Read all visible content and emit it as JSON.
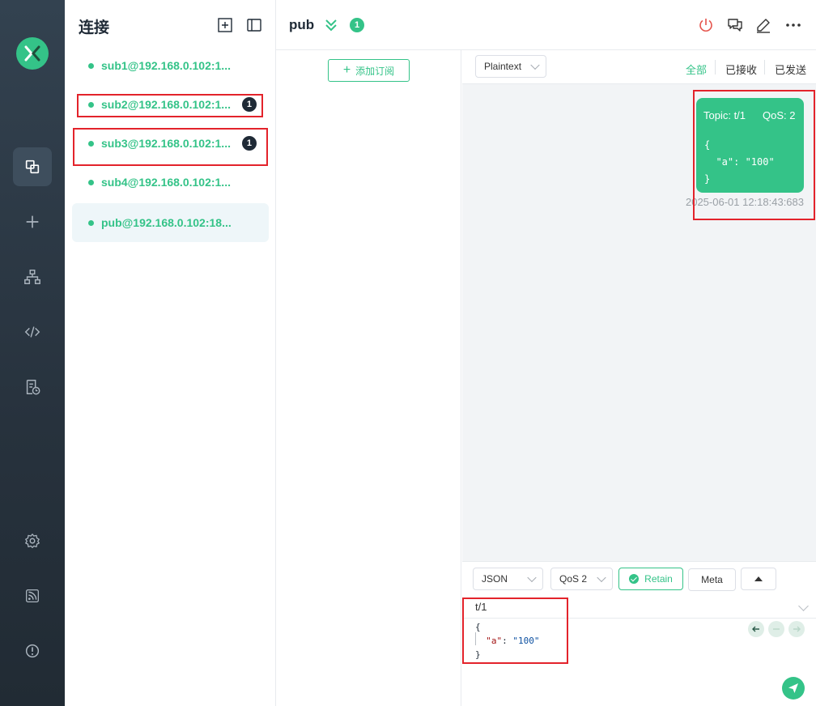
{
  "connections": {
    "title": "连接",
    "items": [
      {
        "name": "sub1@192.168.0.102:1...",
        "badge": ""
      },
      {
        "name": "sub2@192.168.0.102:1...",
        "badge": "1"
      },
      {
        "name": "sub3@192.168.0.102:1...",
        "badge": "1"
      },
      {
        "name": "sub4@192.168.0.102:1...",
        "badge": ""
      },
      {
        "name": "pub@192.168.0.102:18...",
        "badge": ""
      }
    ]
  },
  "header": {
    "title": "pub",
    "badge": "1"
  },
  "subscriptions": {
    "add_label": "添加订阅"
  },
  "messages": {
    "format_select": "Plaintext",
    "filters": {
      "all": "全部",
      "received": "已接收",
      "sent": "已发送"
    },
    "items": [
      {
        "topic": "Topic: t/1",
        "qos": "QoS: 2",
        "payload": "{\n  \"a\": \"100\"\n}",
        "time": "2025-06-01 12:18:43:683"
      }
    ]
  },
  "publish": {
    "format": "JSON",
    "qos": "QoS 2",
    "retain_label": "Retain",
    "meta_label": "Meta",
    "topic": "t/1",
    "payload_open": "{",
    "payload_key": "\"a\"",
    "payload_colon": ": ",
    "payload_value": "\"100\"",
    "payload_close": "}"
  },
  "colors": {
    "accent": "#34c388",
    "nav_bg": "#2b3742",
    "highlight_box": "#e3232b",
    "disconnect": "#e5534b"
  },
  "icons": [
    "mqttx-logo",
    "connections-icon",
    "plus-icon",
    "topology-icon",
    "code-icon",
    "log-icon",
    "settings-icon",
    "feed-icon",
    "info-icon",
    "new-window-icon",
    "sidebar-toggle-icon",
    "chevrons-down-icon",
    "power-icon",
    "chat-icon",
    "edit-icon",
    "more-icon",
    "arrow-left-icon",
    "minus-icon",
    "arrow-right-icon",
    "send-icon"
  ]
}
